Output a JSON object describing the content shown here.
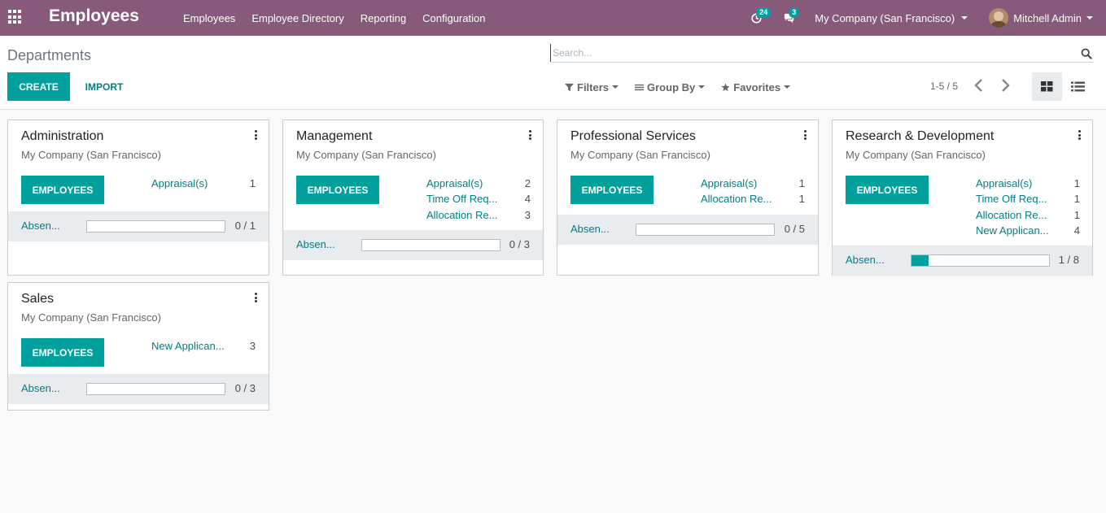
{
  "navbar": {
    "app_title": "Employees",
    "menu": [
      "Employees",
      "Employee Directory",
      "Reporting",
      "Configuration"
    ],
    "activity_badge": "24",
    "messages_badge": "3",
    "company": "My Company (San Francisco)",
    "user": "Mitchell Admin"
  },
  "control": {
    "breadcrumb": "Departments",
    "create_label": "CREATE",
    "import_label": "IMPORT",
    "search_placeholder": "Search...",
    "filters_label": "Filters",
    "groupby_label": "Group By",
    "favorites_label": "Favorites",
    "pager": "1-5 / 5"
  },
  "colors": {
    "navbar": "#875a7b",
    "accent": "#00a09d",
    "link": "#017e84"
  },
  "departments": [
    {
      "name": "Administration",
      "company": "My Company (San Francisco)",
      "button": "EMPLOYEES",
      "stats": [
        {
          "label": "Appraisal(s)",
          "count": "1"
        }
      ],
      "absence_label": "Absen...",
      "absence_count": "0 / 1",
      "absence_fraction": 0
    },
    {
      "name": "Management",
      "company": "My Company (San Francisco)",
      "button": "EMPLOYEES",
      "stats": [
        {
          "label": "Appraisal(s)",
          "count": "2"
        },
        {
          "label": "Time Off Req...",
          "count": "4"
        },
        {
          "label": "Allocation Re...",
          "count": "3"
        }
      ],
      "absence_label": "Absen...",
      "absence_count": "0 / 3",
      "absence_fraction": 0
    },
    {
      "name": "Professional Services",
      "company": "My Company (San Francisco)",
      "button": "EMPLOYEES",
      "stats": [
        {
          "label": "Appraisal(s)",
          "count": "1"
        },
        {
          "label": "Allocation Re...",
          "count": "1"
        }
      ],
      "absence_label": "Absen...",
      "absence_count": "0 / 5",
      "absence_fraction": 0
    },
    {
      "name": "Research & Development",
      "company": "My Company (San Francisco)",
      "button": "EMPLOYEES",
      "stats": [
        {
          "label": "Appraisal(s)",
          "count": "1"
        },
        {
          "label": "Time Off Req...",
          "count": "1"
        },
        {
          "label": "Allocation Re...",
          "count": "1"
        },
        {
          "label": "New Applican...",
          "count": "4"
        }
      ],
      "absence_label": "Absen...",
      "absence_count": "1 / 8",
      "absence_fraction": 0.125
    },
    {
      "name": "Sales",
      "company": "My Company (San Francisco)",
      "button": "EMPLOYEES",
      "stats": [
        {
          "label": "New Applican...",
          "count": "3"
        }
      ],
      "absence_label": "Absen...",
      "absence_count": "0 / 3",
      "absence_fraction": 0
    }
  ]
}
